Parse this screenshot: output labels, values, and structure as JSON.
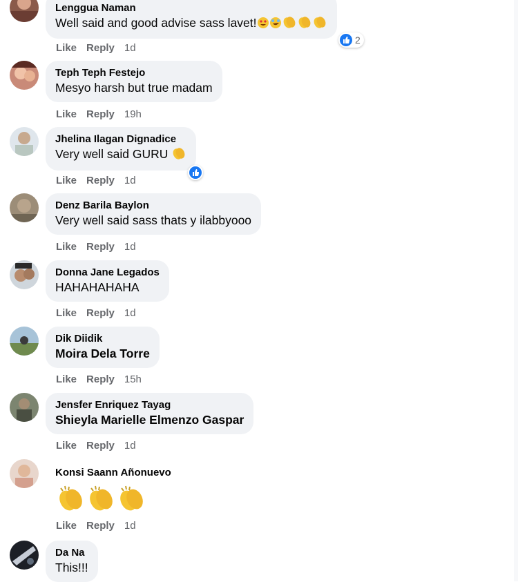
{
  "comments": [
    {
      "author": "Lenggua Naman",
      "text": "Well said and good advise sass lavet!",
      "like": "Like",
      "reply": "Reply",
      "time": "1d",
      "reaction_count": "2"
    },
    {
      "author": "Teph Teph Festejo",
      "text": "Mesyo harsh but true madam",
      "like": "Like",
      "reply": "Reply",
      "time": "19h"
    },
    {
      "author": "Jhelina Ilagan Dignadice",
      "text": "Very well said GURU",
      "like": "Like",
      "reply": "Reply",
      "time": "1d"
    },
    {
      "author": "Denz Barila Baylon",
      "text": "Very well said sass thats y ilabbyooo",
      "like": "Like",
      "reply": "Reply",
      "time": "1d"
    },
    {
      "author": "Donna Jane Legados",
      "text": "HAHAHAHAHA",
      "like": "Like",
      "reply": "Reply",
      "time": "1d"
    },
    {
      "author": "Dik Diidik",
      "text": "Moira Dela Torre",
      "like": "Like",
      "reply": "Reply",
      "time": "15h"
    },
    {
      "author": "Jensfer Enriquez Tayag",
      "text": "Shieyla Marielle Elmenzo Gaspar",
      "like": "Like",
      "reply": "Reply",
      "time": "1d"
    },
    {
      "author": "Konsi Saann Añonuevo",
      "text": "",
      "like": "Like",
      "reply": "Reply",
      "time": "1d"
    },
    {
      "author": "Da Na",
      "text": "This!!!"
    }
  ],
  "icons": {
    "reaction": "like-icon",
    "emoji_love": "heart-eyes-emoji-icon",
    "emoji_laugh": "rofl-emoji-icon",
    "emoji_clap": "clapping-hands-emoji-icon"
  },
  "colors": {
    "bubble": "#f0f2f5",
    "meta": "#65676b",
    "like_blue": "#1877f2",
    "clap": "#f5c431"
  }
}
